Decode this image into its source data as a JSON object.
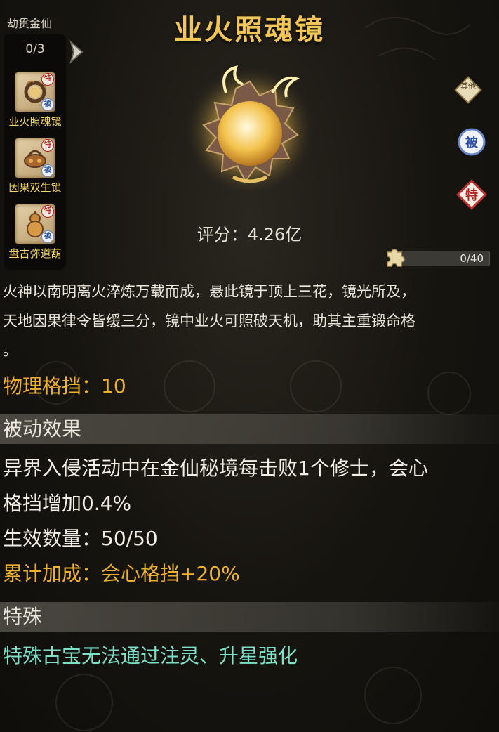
{
  "header": {
    "title": "业火照魂镜",
    "rank": "劫贯金仙"
  },
  "side_panel": {
    "count": "0/3",
    "items": [
      {
        "label": "业火照魂镜",
        "tags": [
          "特",
          "被"
        ]
      },
      {
        "label": "因果双生锁",
        "tags": [
          "特",
          "被"
        ]
      },
      {
        "label": "盘古弥道葫",
        "tags": [
          "特",
          "被"
        ]
      }
    ]
  },
  "score": {
    "label": "评分：",
    "value": "4.26亿"
  },
  "badges": {
    "other": "其他",
    "passive": "被",
    "special": "特"
  },
  "progress": {
    "text": "0/40",
    "value": 0,
    "max": 40
  },
  "description": [
    "火神以南明离火淬炼万载而成，悬此镜于顶上三花，镜光所及，",
    "天地因果律令皆缓三分，镜中业火可照破天机，助其主重锻命格",
    "。"
  ],
  "stat_main": "物理格挡：10",
  "passive_section": {
    "title": "被动效果",
    "lines": [
      "异界入侵活动中在金仙秘境每击败1个修士，会心",
      "格挡增加0.4%"
    ],
    "count_label": "生效数量：50/50",
    "total_label": "累计加成：会心格挡+20%"
  },
  "special_section": {
    "title": "特殊",
    "text": "特殊古宝无法通过注灵、升星强化"
  },
  "colors": {
    "gold": "#efb02c",
    "title": "#f1c657",
    "teal": "#7ee0c8"
  }
}
